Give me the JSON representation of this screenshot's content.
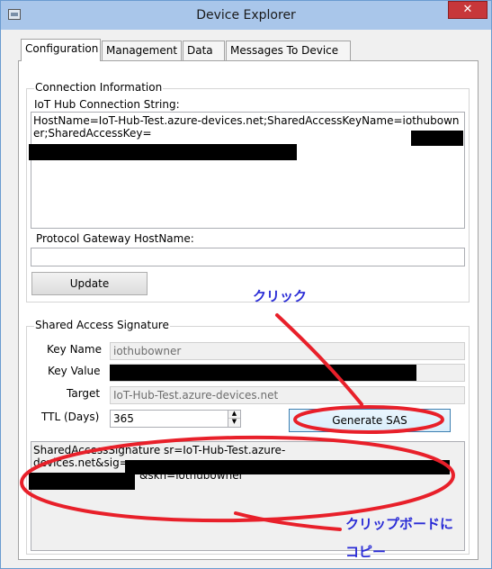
{
  "window": {
    "title": "Device Explorer",
    "close_glyph": "✕",
    "icon": "app-window-icon"
  },
  "tabs": [
    {
      "label": "Configuration",
      "active": true
    },
    {
      "label": "Management",
      "active": false
    },
    {
      "label": "Data",
      "active": false
    },
    {
      "label": "Messages To Device",
      "active": false
    }
  ],
  "connection": {
    "group_label": "Connection Information",
    "conn_string_label": "IoT Hub Connection String:",
    "conn_string_value": "HostName=IoT-Hub-Test.azure-devices.net;SharedAccessKeyName=iothubowner;SharedAccessKey=",
    "gateway_label": "Protocol Gateway HostName:",
    "gateway_value": "",
    "update_button": "Update"
  },
  "sas": {
    "group_label": "Shared Access Signature",
    "key_name_label": "Key Name",
    "key_name_value": "iothubowner",
    "key_value_label": "Key Value",
    "key_value_value": "",
    "target_label": "Target",
    "target_value": "IoT-Hub-Test.azure-devices.net",
    "ttl_label": "TTL (Days)",
    "ttl_value": "365",
    "generate_button": "Generate SAS",
    "output_line1": "SharedAccessSignature sr=IoT-Hub-Test.azure-",
    "output_line2": "devices.net&sig=",
    "output_line3": "&skn=iothubowner"
  },
  "annotations": {
    "click": "クリック",
    "copy_line1": "クリップボードに",
    "copy_line2": "コピー"
  },
  "colors": {
    "annotation_red": "#e8202a",
    "annotation_text": "#2a2cd6",
    "titlebar": "#a9c6ea"
  }
}
